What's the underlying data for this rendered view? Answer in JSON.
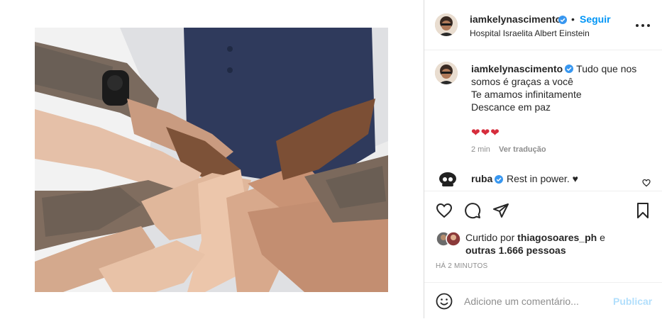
{
  "post": {
    "image_alt": "hands stacked together over a hospital bed"
  },
  "header": {
    "username": "iamkelynascimento",
    "separator": "•",
    "follow_label": "Seguir",
    "location": "Hospital Israelita Albert Einstein"
  },
  "caption": {
    "username": "iamkelynascimento",
    "lines": [
      "Tudo que nos",
      "somos é graças a você",
      "Te amamos infinitamente",
      "Descance em paz"
    ],
    "emoji": "❤❤❤",
    "time": "2 min",
    "translate_label": "Ver tradução"
  },
  "comments": [
    {
      "username": "ruba",
      "text": "Rest in power. ♥"
    }
  ],
  "likes": {
    "prefix": "Curtido por ",
    "user": "thiagosoares_ph",
    "suffix": " e",
    "others": "outras 1.666 pessoas"
  },
  "timestamp": "HÁ 2 MINUTOS",
  "add_comment": {
    "placeholder": "Adicione um comentário...",
    "publish_label": "Publicar"
  },
  "colors": {
    "link": "#0095f6",
    "verified": "#3897f0",
    "publish_disabled": "#b2dffc",
    "secondary_text": "#8e8e8e",
    "heart": "#d62d3c"
  }
}
